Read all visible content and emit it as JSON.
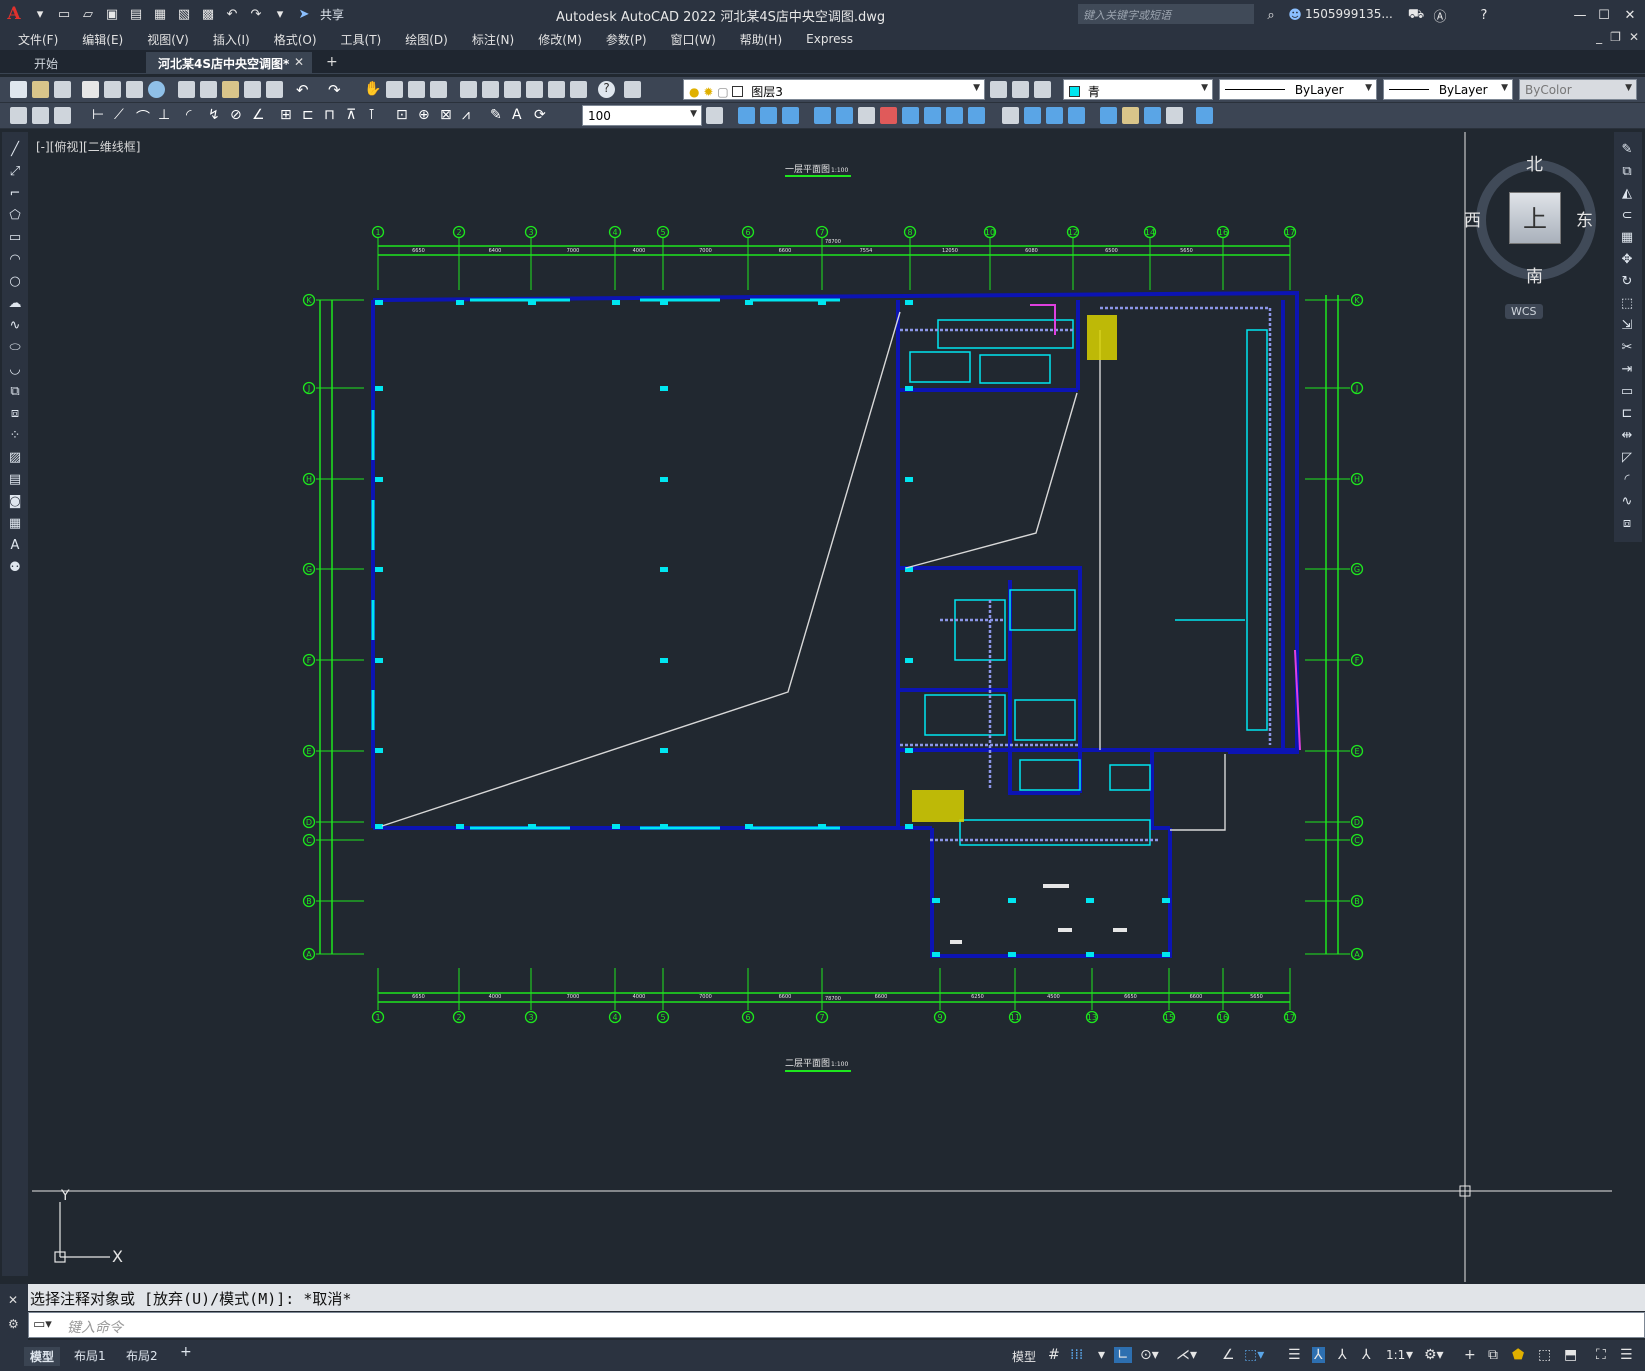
{
  "titlebar": {
    "share_label": "共享",
    "title": "Autodesk AutoCAD 2022    河北某4S店中央空调图.dwg",
    "search_placeholder": "键入关键字或短语",
    "user": "1505999135...",
    "app_letter": "A"
  },
  "menu": [
    "文件(F)",
    "编辑(E)",
    "视图(V)",
    "插入(I)",
    "格式(O)",
    "工具(T)",
    "绘图(D)",
    "标注(N)",
    "修改(M)",
    "参数(P)",
    "窗口(W)",
    "帮助(H)",
    "Express"
  ],
  "tabs": {
    "start": "开始",
    "file": "河北某4S店中央空调图*"
  },
  "toolbar": {
    "layer": "图层3",
    "color": "青",
    "linetype": "ByLayer",
    "lineweight": "ByLayer",
    "plotstyle": "ByColor",
    "scale": "100"
  },
  "viewport": {
    "label": "[-][俯视][二维线框]"
  },
  "drawing": {
    "plan_title_top": "一层平面图",
    "plan_title_bottom": "二层平面图",
    "scale_text": "1:100",
    "top_axes": [
      "1",
      "2",
      "3",
      "4",
      "5",
      "6",
      "7",
      "8",
      "10",
      "12",
      "14",
      "16",
      "17"
    ],
    "bottom_axes": [
      "1",
      "2",
      "3",
      "4",
      "5",
      "6",
      "7",
      "9",
      "11",
      "13",
      "15",
      "16",
      "17"
    ],
    "left_axes": [
      "K",
      "J",
      "H",
      "G",
      "F",
      "E",
      "D",
      "C",
      "B",
      "A"
    ],
    "right_axes": [
      "K",
      "J",
      "H",
      "G",
      "F",
      "E",
      "D",
      "C",
      "B",
      "A"
    ],
    "top_dims": [
      "6650",
      "6400",
      "7000",
      "4000",
      "7000",
      "6600",
      "7554",
      "12050",
      "6080",
      "6500",
      "5650"
    ],
    "top_total": "78700",
    "bottom_dims": [
      "6650",
      "4000",
      "7000",
      "4000",
      "7000",
      "6600",
      "6600",
      "6250",
      "4500",
      "6650",
      "6600",
      "5650"
    ],
    "bottom_total": "78700"
  },
  "viewcube": {
    "north": "北",
    "south": "南",
    "east": "东",
    "west": "西",
    "top": "上",
    "wcs": "WCS"
  },
  "ucs": {
    "x": "X",
    "y": "Y"
  },
  "command": {
    "history": "选择注释对象或 [放弃(U)/模式(M)]: *取消*",
    "prompt": "键入命令"
  },
  "status": {
    "model_tab": "模型",
    "layout1": "布局1",
    "layout2": "布局2",
    "model": "模型",
    "scale": "1:1"
  },
  "colors": {
    "background": "#212830",
    "grid_green": "#1ee61e",
    "wall_blue": "#0c14b4",
    "duct_cyan": "#00e6f0"
  }
}
